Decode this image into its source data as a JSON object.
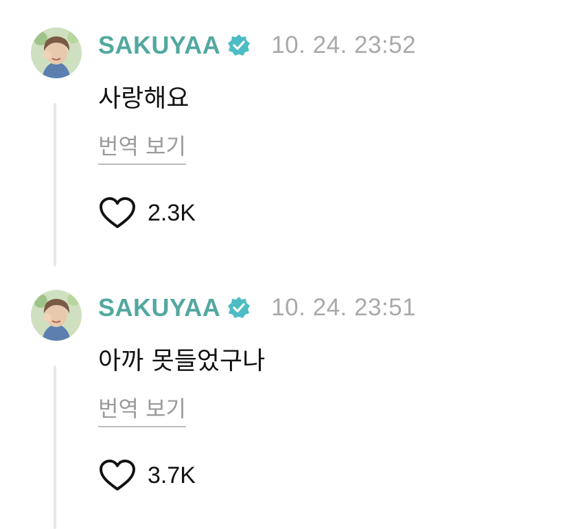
{
  "posts": [
    {
      "username": "SAKUYAA",
      "timestamp": "10. 24. 23:52",
      "message": "사랑해요",
      "translate_label": "번역 보기",
      "likes": "2.3K",
      "icons": {
        "verified": "verified-badge-icon",
        "like": "heart-outline-icon"
      }
    },
    {
      "username": "SAKUYAA",
      "timestamp": "10. 24. 23:51",
      "message": "아까 못들었구나",
      "translate_label": "번역 보기",
      "likes": "3.7K",
      "icons": {
        "verified": "verified-badge-icon",
        "like": "heart-outline-icon"
      }
    }
  ],
  "colors": {
    "username": "#52a8a0",
    "verified_badge": "#4dbcc4",
    "timestamp": "#a9a9a9",
    "translate_link": "#9a9a9a",
    "thread_line": "#e8e8e8"
  }
}
